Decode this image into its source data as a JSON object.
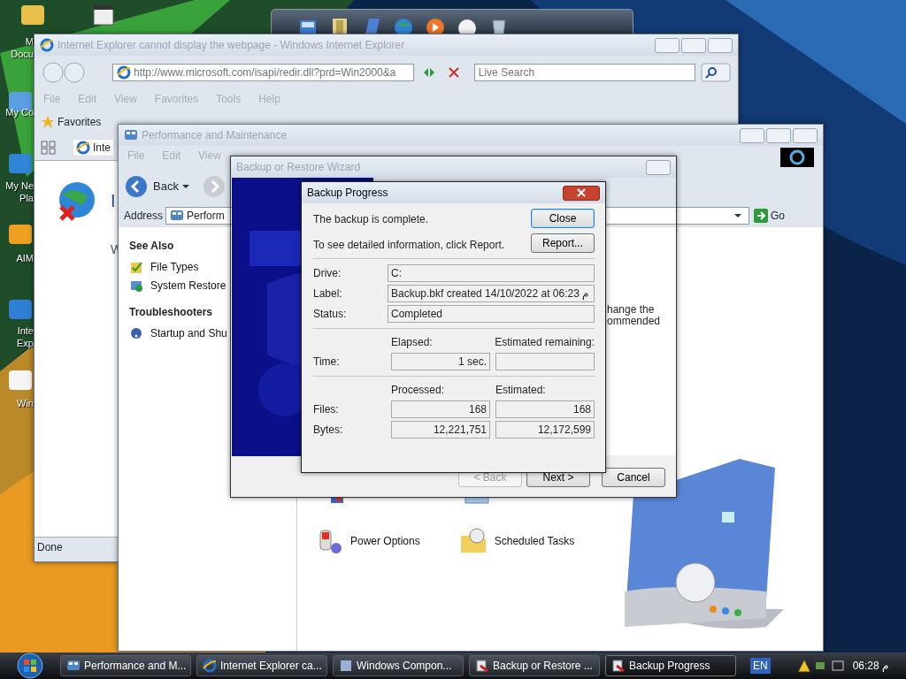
{
  "desktop": {
    "icons": [
      {
        "lines": [
          "M",
          "Docu"
        ]
      },
      {
        "lines": [
          "My Co"
        ]
      },
      {
        "lines": [
          "My Ne",
          "Pla"
        ]
      },
      {
        "lines": [
          "AIM"
        ]
      },
      {
        "lines": [
          "Inte",
          "Exp"
        ]
      },
      {
        "lines": [
          "Win"
        ]
      }
    ]
  },
  "ie_window": {
    "title": "Internet Explorer cannot display the webpage - Windows Internet Explorer",
    "address": "http://www.microsoft.com/isapi/redir.dll?prd=Win2000&a",
    "search_placeholder": "Live Search",
    "menu": [
      "File",
      "Edit",
      "View",
      "Favorites",
      "Tools",
      "Help"
    ],
    "favorites_button": "Favorites",
    "tab": "Inte",
    "heading_fragment": "I",
    "body_fragment": "W",
    "status": "Done"
  },
  "perf_window": {
    "title": "Performance and Maintenance",
    "menu": [
      "File",
      "Edit",
      "View"
    ],
    "back_button": "Back",
    "address_label": "Address",
    "address_value": "Perform",
    "go_button": "Go",
    "see_also": {
      "heading": "See Also",
      "items": [
        "File Types",
        "System Restore"
      ]
    },
    "troubleshooters": {
      "heading": "Troubleshooters",
      "items": [
        "Startup and Shu"
      ]
    },
    "description_fragments": [
      "hange the",
      "ommended"
    ],
    "tasks": [
      "Power Options",
      "Scheduled Tasks"
    ]
  },
  "wizard": {
    "title": "Backup or Restore Wizard",
    "buttons": [
      {
        "label": "< Back",
        "disabled": true
      },
      {
        "label": "Next >",
        "disabled": false
      },
      {
        "label": "Cancel",
        "disabled": false
      }
    ]
  },
  "progress_dialog": {
    "title": "Backup Progress",
    "message": "The backup is complete.",
    "hint": "To see detailed information, click Report.",
    "close_button": "Close",
    "report_button": "Report...",
    "fields": [
      {
        "label": "Drive:",
        "value": "C:"
      },
      {
        "label": "Label:",
        "value": "Backup.bkf created 14/10/2022 at 06:23 م"
      },
      {
        "label": "Status:",
        "value": "Completed"
      }
    ],
    "time": {
      "label": "Time:",
      "elapsed_heading": "Elapsed:",
      "remaining_heading": "Estimated remaining:",
      "elapsed": "1 sec."
    },
    "counts_headings": [
      "Processed:",
      "Estimated:"
    ],
    "counts": [
      {
        "label": "Files:",
        "processed": "168",
        "estimated": "168"
      },
      {
        "label": "Bytes:",
        "processed": "12,221,751",
        "estimated": "12,172,599"
      }
    ]
  },
  "taskbar": {
    "tasks": [
      {
        "label": "Performance and M...",
        "selected": false
      },
      {
        "label": "Internet Explorer ca...",
        "selected": false
      },
      {
        "label": "Windows Compon...",
        "selected": false
      },
      {
        "label": "Backup or Restore ...",
        "selected": false
      },
      {
        "label": "Backup Progress",
        "selected": true
      }
    ],
    "language": "EN",
    "clock": "06:28 م"
  }
}
